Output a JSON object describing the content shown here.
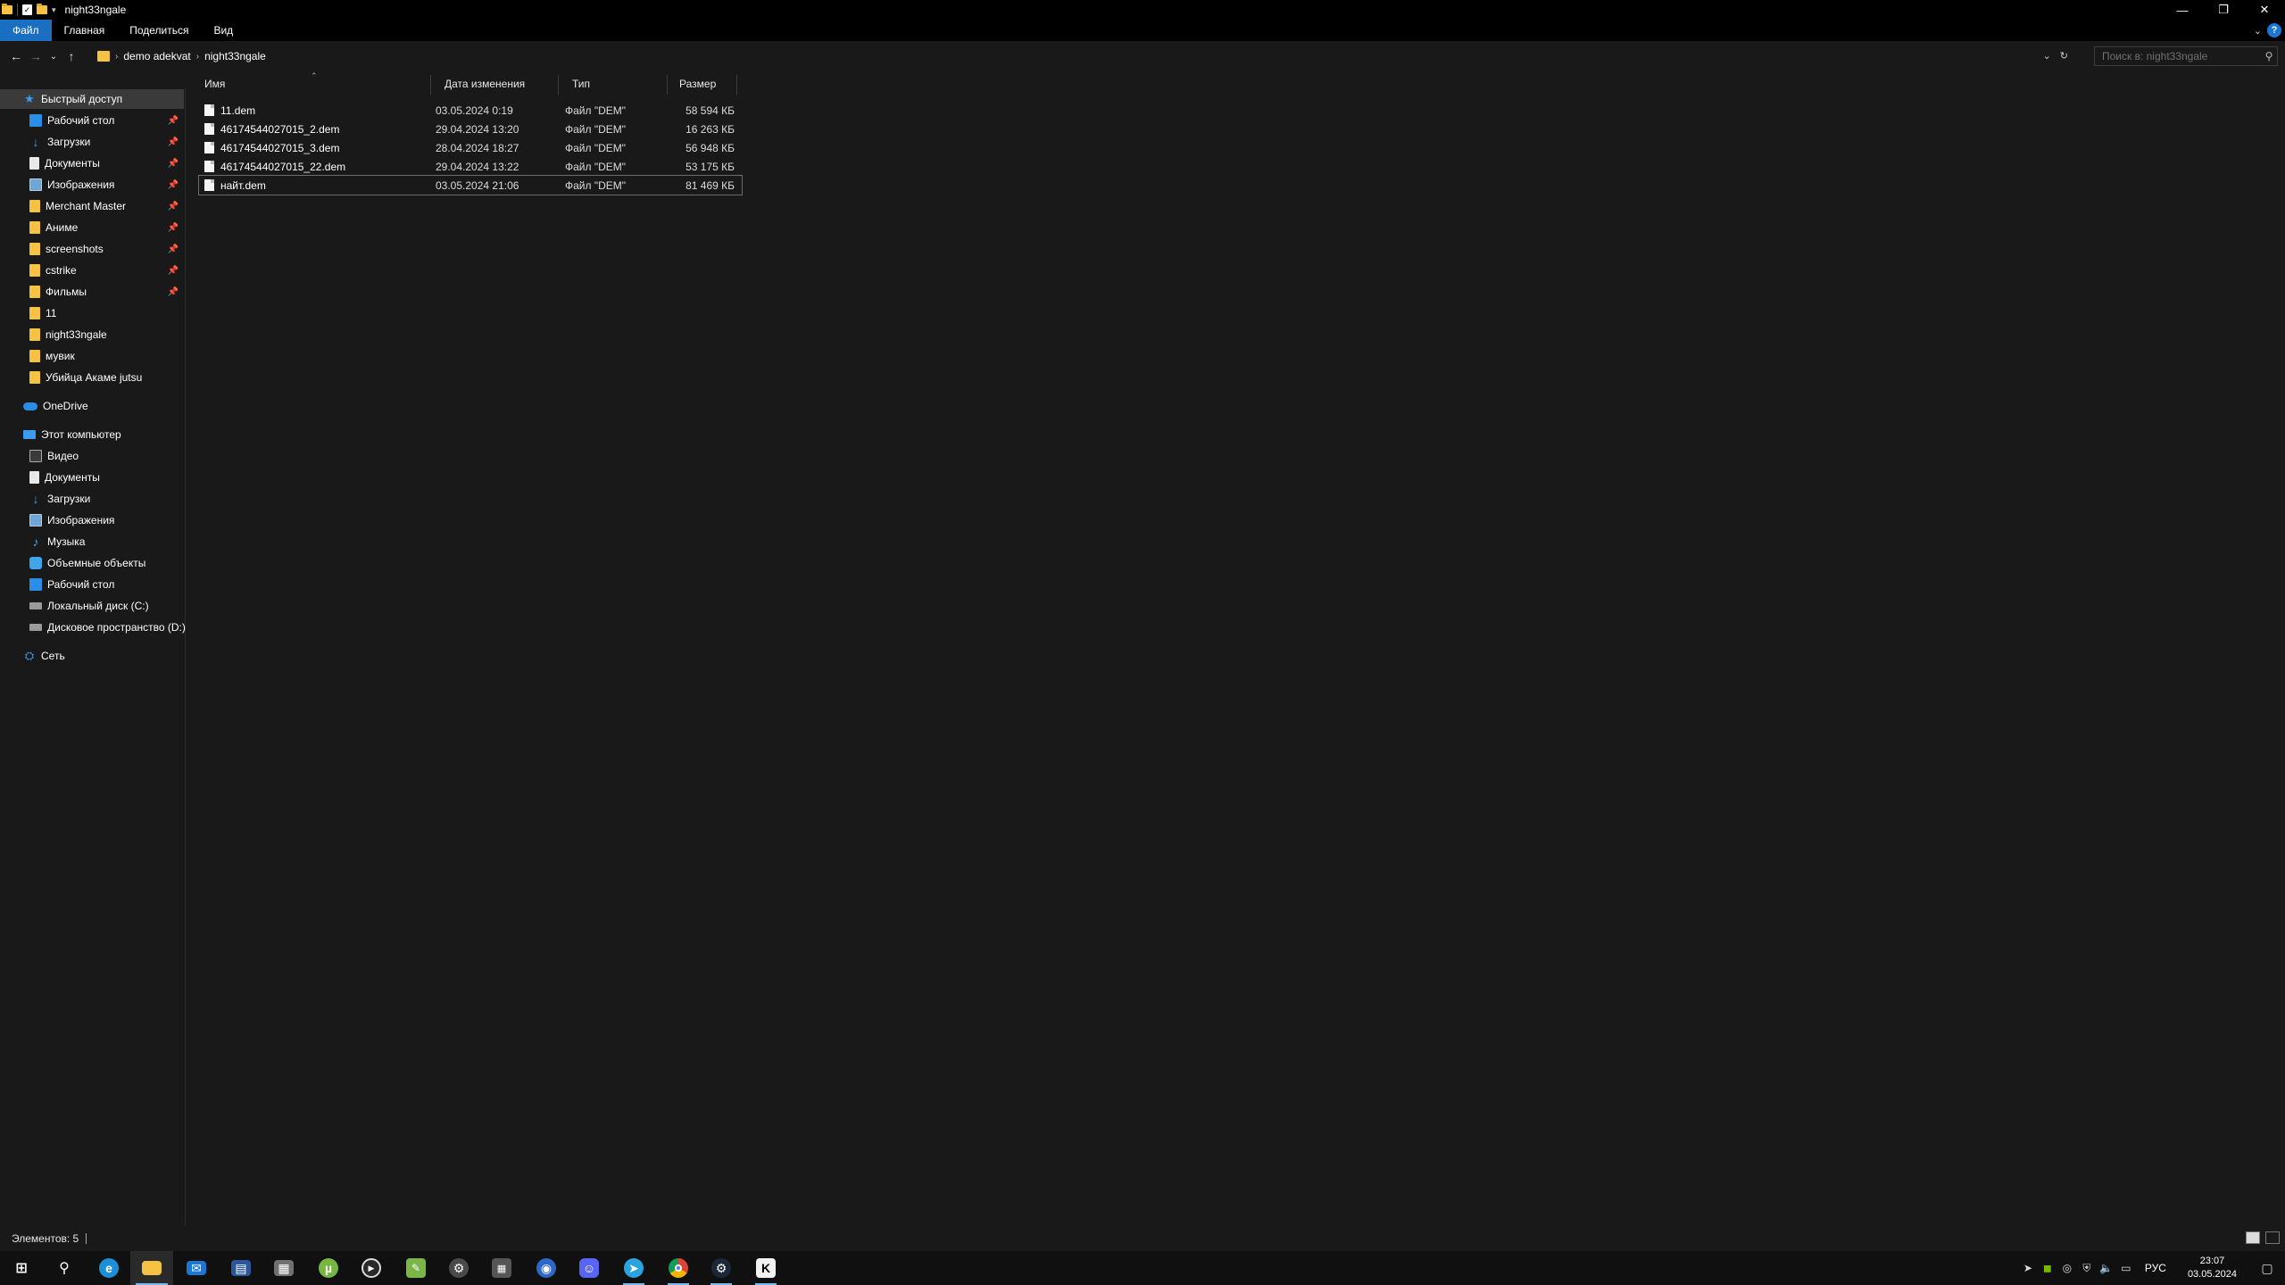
{
  "window": {
    "title": "night33ngale",
    "controls": {
      "minimize": "—",
      "maximize": "❐",
      "close": "✕"
    }
  },
  "ribbon": {
    "tabs": [
      "Файл",
      "Главная",
      "Поделиться",
      "Вид"
    ],
    "active_tab": "Файл",
    "help": "?"
  },
  "address": {
    "crumbs": [
      "demo adekvat",
      "night33ngale"
    ],
    "search_placeholder": "Поиск в: night33ngale"
  },
  "sidebar": {
    "quick_access": "Быстрый доступ",
    "pinned": [
      {
        "label": "Рабочий стол",
        "icon": "desktop-icon",
        "pinned": true
      },
      {
        "label": "Загрузки",
        "icon": "downloads-icon",
        "pinned": true
      },
      {
        "label": "Документы",
        "icon": "documents-icon",
        "pinned": true
      },
      {
        "label": "Изображения",
        "icon": "pictures-icon",
        "pinned": true
      },
      {
        "label": "Merchant Master",
        "icon": "folder-icon",
        "pinned": true
      },
      {
        "label": "Аниме",
        "icon": "folder-icon",
        "pinned": true
      },
      {
        "label": "screenshots",
        "icon": "folder-icon",
        "pinned": true
      },
      {
        "label": "cstrike",
        "icon": "folder-icon",
        "pinned": true
      },
      {
        "label": "Фильмы",
        "icon": "folder-icon",
        "pinned": true
      },
      {
        "label": "11",
        "icon": "folder-icon",
        "pinned": false
      },
      {
        "label": "night33ngale",
        "icon": "folder-icon",
        "pinned": false
      },
      {
        "label": "мувик",
        "icon": "folder-icon",
        "pinned": false
      },
      {
        "label": "Убийца Акаме jutsu",
        "icon": "folder-icon",
        "pinned": false
      }
    ],
    "onedrive": "OneDrive",
    "this_pc": "Этот компьютер",
    "pc_items": [
      {
        "label": "Видео",
        "icon": "video-icon"
      },
      {
        "label": "Документы",
        "icon": "documents-icon"
      },
      {
        "label": "Загрузки",
        "icon": "downloads-icon"
      },
      {
        "label": "Изображения",
        "icon": "pictures-icon"
      },
      {
        "label": "Музыка",
        "icon": "music-icon"
      },
      {
        "label": "Объемные объекты",
        "icon": "3d-objects-icon"
      },
      {
        "label": "Рабочий стол",
        "icon": "desktop-icon"
      },
      {
        "label": "Локальный диск (C:)",
        "icon": "drive-icon"
      },
      {
        "label": "Дисковое пространство (D:)",
        "icon": "drive-icon"
      }
    ],
    "network": "Сеть"
  },
  "files": {
    "columns": [
      "Имя",
      "Дата изменения",
      "Тип",
      "Размер"
    ],
    "rows": [
      {
        "name": "11.dem",
        "date": "03.05.2024 0:19",
        "type": "Файл \"DEM\"",
        "size": "58 594 КБ"
      },
      {
        "name": "46174544027015_2.dem",
        "date": "29.04.2024 13:20",
        "type": "Файл \"DEM\"",
        "size": "16 263 КБ"
      },
      {
        "name": "46174544027015_3.dem",
        "date": "28.04.2024 18:27",
        "type": "Файл \"DEM\"",
        "size": "56 948 КБ"
      },
      {
        "name": "46174544027015_22.dem",
        "date": "29.04.2024 13:22",
        "type": "Файл \"DEM\"",
        "size": "53 175 КБ"
      },
      {
        "name": "найт.dem",
        "date": "03.05.2024 21:06",
        "type": "Файл \"DEM\"",
        "size": "81 469 КБ"
      }
    ],
    "selected_row": "найт.dem"
  },
  "status": {
    "items_count": "Элементов: 5"
  },
  "taskbar": {
    "apps": [
      "start",
      "search",
      "edge",
      "file-explorer",
      "mail",
      "outlook",
      "media",
      "utorrent",
      "player",
      "notepad",
      "settings",
      "calculator",
      "app-blue",
      "discord",
      "telegram",
      "chrome",
      "steam",
      "cs-app"
    ],
    "active_app": "file-explorer",
    "language": "РУС",
    "time": "23:07",
    "date": "03.05.2024"
  }
}
